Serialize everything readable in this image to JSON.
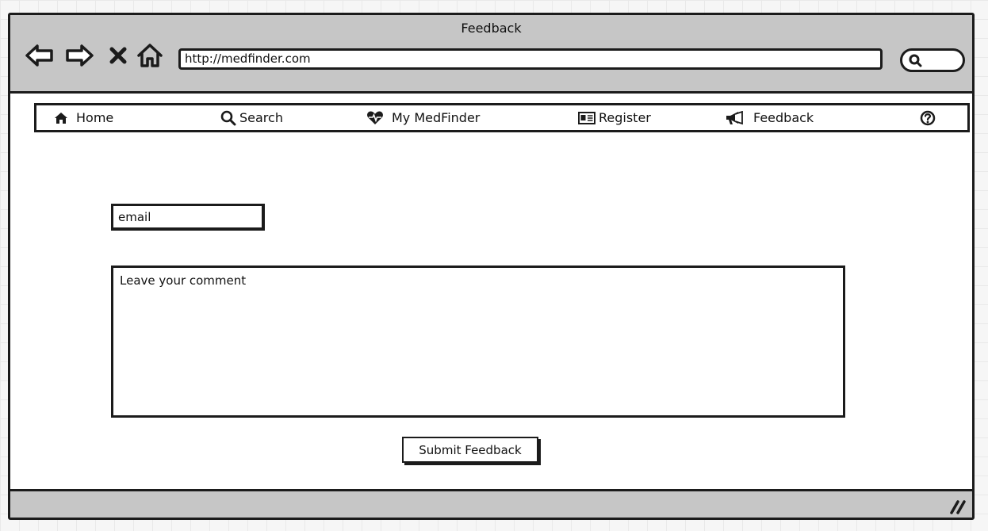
{
  "window": {
    "title": "Feedback",
    "url": "http://medfinder.com",
    "nav_icons": [
      "back-arrow-icon",
      "forward-arrow-icon",
      "close-x-icon",
      "home-outline-icon"
    ],
    "search_icon": "search-icon"
  },
  "menu": {
    "items": [
      {
        "label": "Home",
        "icon": "home-icon"
      },
      {
        "label": "Search",
        "icon": "search-icon"
      },
      {
        "label": "My MedFinder",
        "icon": "heartbeat-icon"
      },
      {
        "label": "Register",
        "icon": "id-card-icon"
      },
      {
        "label": "Feedback",
        "icon": "megaphone-icon"
      }
    ],
    "help_icon": "help-icon"
  },
  "form": {
    "email_placeholder": "email",
    "comment_placeholder": "Leave your comment",
    "submit_label": "Submit Feedback"
  },
  "colors": {
    "chrome": "#c6c6c6",
    "border": "#1b1b1b",
    "background": "#ffffff"
  }
}
